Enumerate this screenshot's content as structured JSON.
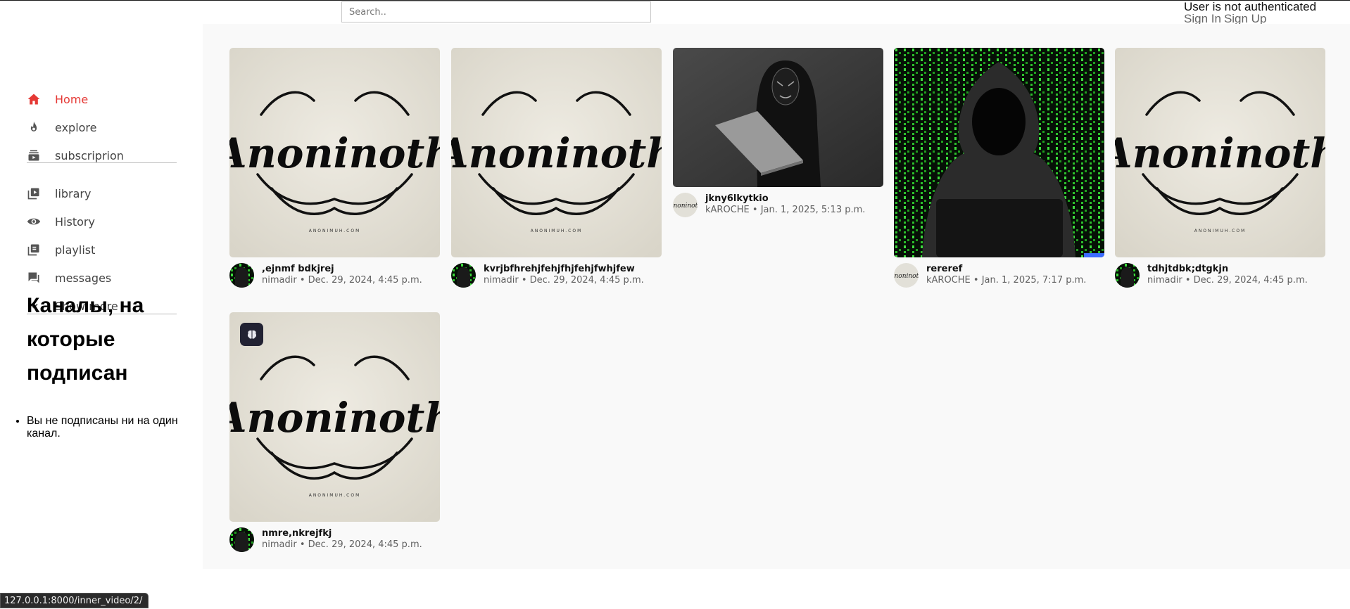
{
  "search": {
    "placeholder": "Search.."
  },
  "auth": {
    "status": "User is not authenticated",
    "sign_in": "Sign In",
    "sign_up": "Sign Up"
  },
  "sidebar": {
    "items": [
      {
        "label": "Home",
        "icon": "home-icon",
        "active": true
      },
      {
        "label": "explore",
        "icon": "flame-icon"
      },
      {
        "label": "subscriprion",
        "icon": "subscriptions-icon"
      },
      {
        "label": "library",
        "icon": "library-icon"
      },
      {
        "label": "History",
        "icon": "eye-icon"
      },
      {
        "label": "playlist",
        "icon": "playlist-icon"
      },
      {
        "label": "messages",
        "icon": "messages-icon"
      },
      {
        "label": "Show more",
        "icon": "chevron-down-icon"
      }
    ],
    "channels_title": "Каналы, на которые подписан",
    "channels_empty": "Вы не подписаны ни на один канал."
  },
  "videos": [
    {
      "title": ",ejnmf bdkjrej",
      "author": "nimadir",
      "date": "Dec. 29, 2024, 4:45 p.m.",
      "thumb": "anoninoth-logo"
    },
    {
      "title": "kvrjbfhrehjfehjfhjfehjfwhjfew",
      "author": "nimadir",
      "date": "Dec. 29, 2024, 4:45 p.m.",
      "thumb": "anoninoth-logo"
    },
    {
      "title": "jkny6lkytkio",
      "author": "kAROCHE",
      "date": "Jan. 1, 2025, 5:13 p.m.",
      "thumb": "masked-hacker-photo"
    },
    {
      "title": "rereref",
      "author": "kAROCHE",
      "date": "Jan. 1, 2025, 7:17 p.m.",
      "thumb": "matrix-hacker-photo"
    },
    {
      "title": "tdhjtdbk;dtgkjn",
      "author": "nimadir",
      "date": "Dec. 29, 2024, 4:45 p.m.",
      "thumb": "anoninoth-logo"
    },
    {
      "title": "nmre,nkrejfkj",
      "author": "nimadir",
      "date": "Dec. 29, 2024, 4:45 p.m.",
      "thumb": "anoninoth-logo"
    }
  ],
  "separator": "•",
  "logo_text": "Anoninoth",
  "logo_url": "ANONIMUH.COM",
  "status_url": "127.0.0.1:8000/inner_video/2/",
  "colors": {
    "accent": "#e53935",
    "main_bg": "#f9f9f9"
  }
}
